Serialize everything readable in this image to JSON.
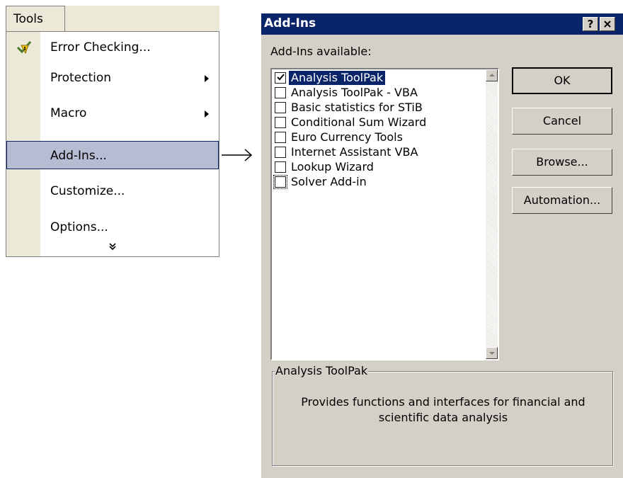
{
  "menu": {
    "title": "Tools",
    "items": [
      {
        "label": "Error Checking...",
        "submenu": false
      },
      {
        "label": "Protection",
        "submenu": true
      },
      {
        "label": "Macro",
        "submenu": true
      },
      {
        "label": "Add-Ins...",
        "submenu": false,
        "highlighted": true
      },
      {
        "label": "Customize...",
        "submenu": false
      },
      {
        "label": "Options...",
        "submenu": false
      }
    ],
    "expand_glyph": "»",
    "first_item_icon": "error-checking-icon"
  },
  "dialog": {
    "title": "Add-Ins",
    "help_label": "?",
    "close_label": "✕",
    "available_label": "Add-Ins available:",
    "addins": [
      {
        "label": "Analysis ToolPak",
        "checked": true,
        "selected": true
      },
      {
        "label": "Analysis ToolPak - VBA",
        "checked": false
      },
      {
        "label": "Basic statistics for STiB",
        "checked": false
      },
      {
        "label": "Conditional Sum Wizard",
        "checked": false
      },
      {
        "label": "Euro Currency Tools",
        "checked": false
      },
      {
        "label": "Internet Assistant VBA",
        "checked": false
      },
      {
        "label": "Lookup Wizard",
        "checked": false
      },
      {
        "label": "Solver Add-in",
        "checked": false,
        "focused": true
      }
    ],
    "buttons": {
      "ok": "OK",
      "cancel": "Cancel",
      "browse": "Browse...",
      "automation": "Automation..."
    },
    "description": {
      "title": "Analysis ToolPak",
      "text": "Provides functions and interfaces for financial and scientific data analysis"
    }
  },
  "colors": {
    "title_bar": "#0a246a",
    "dialog_face": "#d4d0c8",
    "menu_highlight": "#b6bdd2"
  }
}
